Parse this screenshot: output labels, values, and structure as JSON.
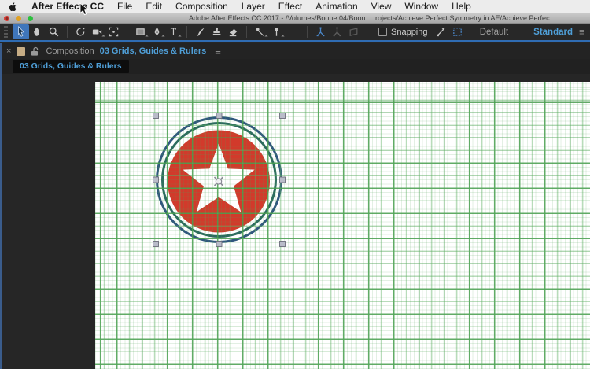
{
  "menu_bar": {
    "items": [
      "After Effects CC",
      "File",
      "Edit",
      "Composition",
      "Layer",
      "Effect",
      "Animation",
      "View",
      "Window",
      "Help"
    ]
  },
  "title_bar": {
    "title": "Adobe After Effects CC 2017 - /Volumes/Boone 04/Boon ... rojects/Achieve Perfect Symmetry in AE/Achieve Perfec"
  },
  "toolbar": {
    "tools": [
      "selection-tool",
      "hand-tool",
      "zoom-tool",
      "rotation-tool",
      "camera-tool",
      "pan-behind-tool",
      "rectangle-tool",
      "pen-tool",
      "type-tool",
      "brush-tool",
      "clone-stamp-tool",
      "eraser-tool",
      "roto-brush-tool",
      "puppet-pin-tool",
      "local-axis-mode",
      "world-axis-mode",
      "view-axis-mode",
      "snap-guides-icon",
      "snap-features-icon"
    ],
    "active_tool": "selection-tool",
    "snapping_label": "Snapping",
    "snapping_checked": false,
    "workspaces": {
      "default": "Default",
      "standard": "Standard"
    },
    "active_workspace": "Standard",
    "more_icon": "≡"
  },
  "composition_panel": {
    "close_icon": "×",
    "panel_label": "Composition",
    "composition_name": "03 Grids, Guides & Rulers",
    "menu_icon": "≡"
  },
  "viewer": {
    "tab_label": "03 Grids, Guides & Rulers"
  },
  "canvas": {
    "artwork": "red circle with white five-point star and two concentric ring strokes, selected with 8 handles and anchor point",
    "colors": {
      "accent_blue": "#4f9fd8",
      "star_circle_red": "#d23a2b",
      "outer_ring": "#30577e",
      "inner_ring": "#2b6a5e",
      "grid_major_green": "#2d8c34",
      "grid_minor_green": "#a8d8ab",
      "selection_handle": "#b9bcc9",
      "pasteboard": "#262626",
      "panel_focus_border": "#3a5c8c"
    }
  }
}
